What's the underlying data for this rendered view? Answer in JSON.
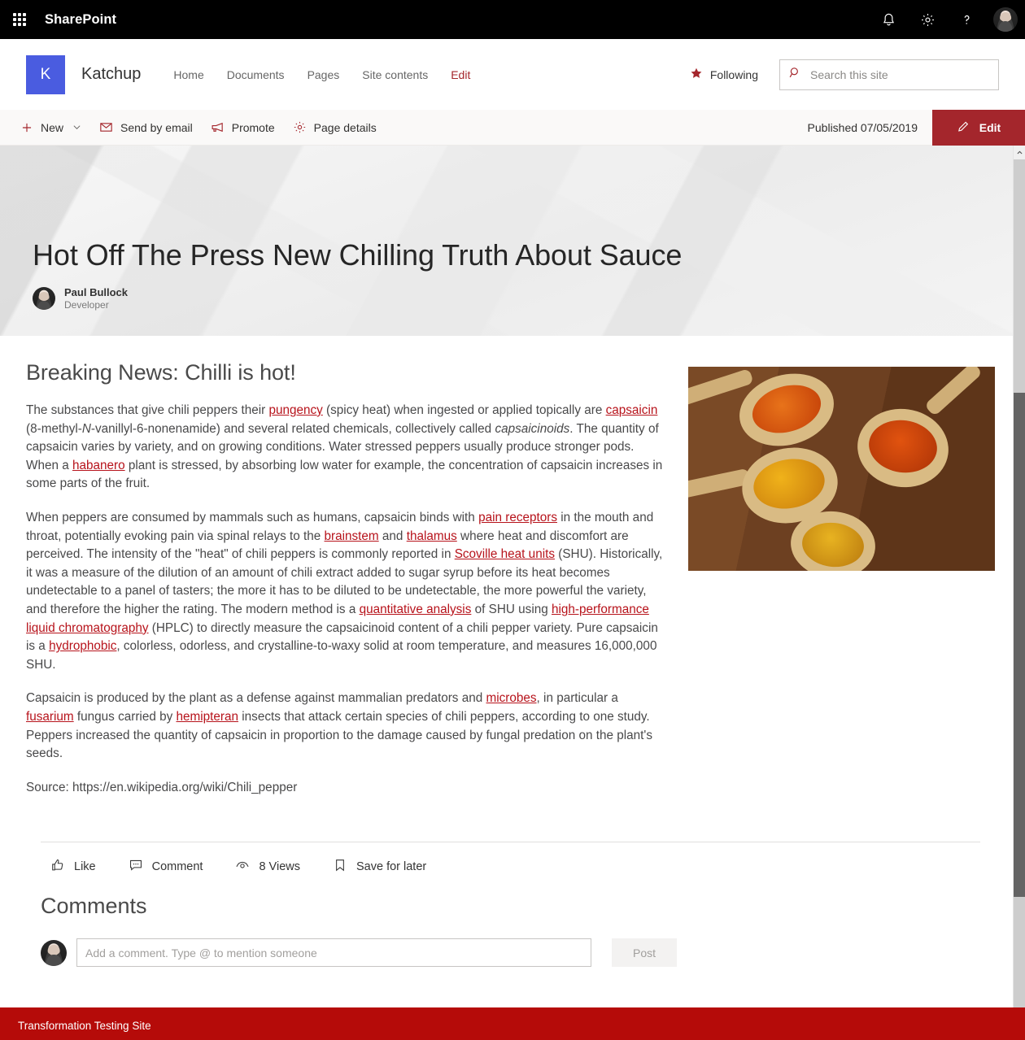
{
  "suite": {
    "brand": "SharePoint",
    "waffle_icon": "app-launcher-icon",
    "icons": [
      {
        "name": "notifications-icon",
        "label": "Notifications"
      },
      {
        "name": "settings-gear-icon",
        "label": "Settings"
      },
      {
        "name": "help-question-icon",
        "label": "Help"
      }
    ],
    "avatar": "user-avatar"
  },
  "site": {
    "logo_letter": "K",
    "title": "Katchup",
    "nav": [
      {
        "label": "Home",
        "accent": false
      },
      {
        "label": "Documents",
        "accent": false
      },
      {
        "label": "Pages",
        "accent": false
      },
      {
        "label": "Site contents",
        "accent": false
      },
      {
        "label": "Edit",
        "accent": true
      }
    ],
    "following_label": "Following",
    "search_placeholder": "Search this site",
    "search_value": ""
  },
  "command_bar": {
    "new_label": "New",
    "send_by_email_label": "Send by email",
    "promote_label": "Promote",
    "page_details_label": "Page details",
    "published_label": "Published 07/05/2019",
    "edit_label": "Edit"
  },
  "hero": {
    "title": "Hot Off The Press New Chilling Truth About Sauce",
    "author_name": "Paul Bullock",
    "author_role": "Developer"
  },
  "article": {
    "heading": "Breaking News: Chilli is hot!",
    "p1_a": "The substances that give chili peppers their ",
    "p1_link1": "pungency",
    "p1_b": " (spicy heat) when ingested or applied topically are ",
    "p1_link2": "capsaicin",
    "p1_c": " (8-methyl-",
    "p1_italic1": "N",
    "p1_d": "-vanillyl-6-nonenamide) and several related chemicals, collectively called ",
    "p1_italic2": "capsaicinoids",
    "p1_e": ". The quantity of capsaicin varies by variety, and on growing conditions. Water stressed peppers usually produce stronger pods. When a ",
    "p1_link3": "habanero",
    "p1_f": " plant is stressed, by absorbing low water for example, the concentration of capsaicin increases in some parts of the fruit.",
    "p2_a": "When peppers are consumed by mammals such as humans, capsaicin binds with ",
    "p2_link1": "pain receptors",
    "p2_b": " in the mouth and throat, potentially evoking pain via spinal relays to the ",
    "p2_link2": "brainstem",
    "p2_c": " and ",
    "p2_link3": "thalamus",
    "p2_d": " where heat and discomfort are perceived. The intensity of the \"heat\" of chili peppers is commonly reported in ",
    "p2_link4": "Scoville heat units",
    "p2_e": " (SHU). Historically, it was a measure of the dilution of an amount of chili extract added to sugar syrup before its heat becomes undetectable to a panel of tasters; the more it has to be diluted to be undetectable, the more powerful the variety, and therefore the higher the rating. The modern method is a ",
    "p2_link5": "quantitative analysis",
    "p2_f": " of SHU using ",
    "p2_link6": "high-performance liquid chromatography",
    "p2_g": " (HPLC) to directly measure the capsaicinoid content of a chili pepper variety. Pure capsaicin is a ",
    "p2_link7": "hydrophobic",
    "p2_h": ", colorless, odorless, and crystalline-to-waxy solid at room temperature, and measures 16,000,000 SHU.",
    "p3_a": "Capsaicin is produced by the plant as a defense against mammalian predators and ",
    "p3_link1": "microbes",
    "p3_b": ", in particular a ",
    "p3_link2": "fusarium",
    "p3_c": " fungus carried by ",
    "p3_link3": "hemipteran",
    "p3_d": " insects that attack certain species of chili peppers, according to one study. Peppers increased the quantity of capsaicin in proportion to the damage caused by fungal predation on the plant's seeds.",
    "source": "Source: https://en.wikipedia.org/wiki/Chili_pepper",
    "image_alt": "spice-powders-on-wooden-spoons"
  },
  "social": [
    {
      "icon": "thumbs-up-icon",
      "label": "Like"
    },
    {
      "icon": "comment-bubble-icon",
      "label": "Comment"
    },
    {
      "icon": "eye-icon",
      "label": "8 Views"
    },
    {
      "icon": "bookmark-icon",
      "label": "Save for later"
    }
  ],
  "comments": {
    "heading": "Comments",
    "input_placeholder": "Add a comment. Type @ to mention someone",
    "input_value": "",
    "post_label": "Post"
  },
  "footer": {
    "text": "Transformation Testing Site"
  },
  "colors": {
    "suite_bar": "#000000",
    "accent_red": "#a4262c",
    "link_red": "#b7131b",
    "footer_red": "#b50b09",
    "logo_blue": "#4a5ce0"
  }
}
